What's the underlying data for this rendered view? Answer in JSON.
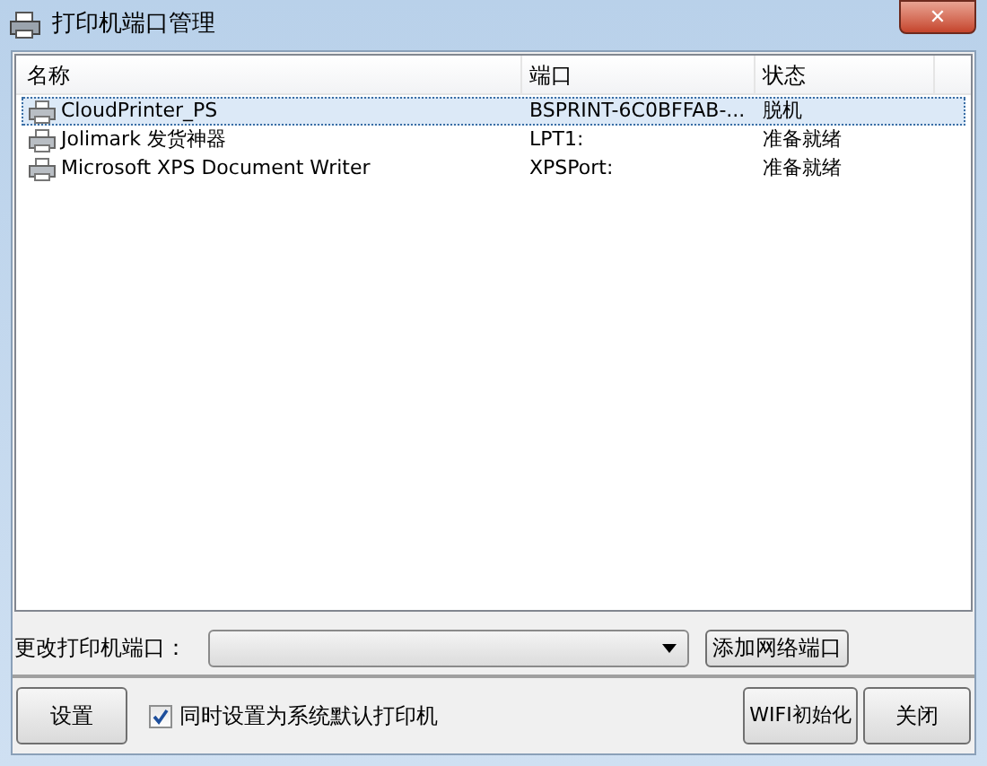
{
  "window": {
    "title": "打印机端口管理",
    "close": "✕"
  },
  "table": {
    "columns": [
      "名称",
      "端口",
      "状态"
    ],
    "rows": [
      {
        "name": "CloudPrinter_PS",
        "port": "BSPRINT-6C0BFFAB-...",
        "status": "脱机",
        "selected": true
      },
      {
        "name": "Jolimark 发货神器",
        "port": "LPT1:",
        "status": "准备就绪",
        "selected": false
      },
      {
        "name": "Microsoft XPS Document Writer",
        "port": "XPSPort:",
        "status": "准备就绪",
        "selected": false
      }
    ]
  },
  "port_change": {
    "label": "更改打印机端口：",
    "button": "添加网络端口"
  },
  "footer": {
    "settings_button": "设置",
    "default_checkbox": {
      "label": "同时设置为系统默认打印机",
      "checked": true
    },
    "wifi_button": "WIFI初始化",
    "close_button": "关闭"
  }
}
